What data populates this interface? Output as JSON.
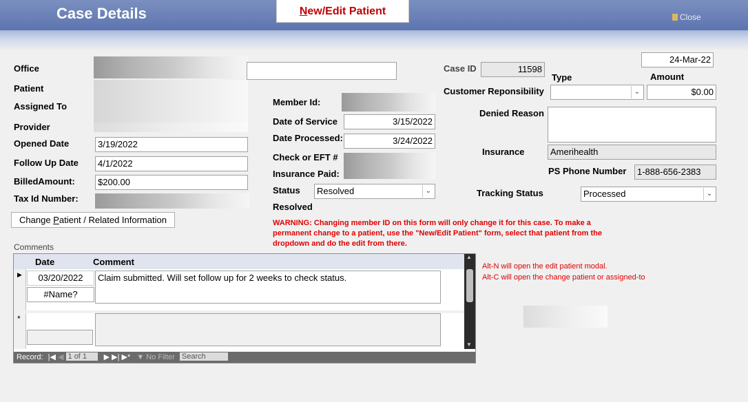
{
  "header": {
    "title": "Case Details",
    "new_edit_button": {
      "accel": "N",
      "rest": "ew/Edit Patient"
    },
    "close_label": "Close"
  },
  "left": {
    "office_label": "Office",
    "patient_label": "Patient",
    "assigned_to_label": "Assigned To",
    "provider_label": "Provider",
    "opened_date_label": "Opened Date",
    "opened_date": "3/19/2022",
    "follow_up_label": "Follow Up Date",
    "follow_up_date": "4/1/2022",
    "billed_amount_label": "BilledAmount:",
    "billed_amount": "$200.00",
    "tax_id_label": "Tax Id Number:",
    "change_button": {
      "pre": "Change ",
      "accel": "P",
      "post": "atient / Related Information"
    }
  },
  "middle": {
    "member_id_label": "Member Id:",
    "date_of_service_label": "Date of Service",
    "date_of_service": "3/15/2022",
    "date_processed_label": "Date Processed:",
    "date_processed": "3/24/2022",
    "check_eft_label": "Check or EFT #",
    "insurance_paid_label": "Insurance Paid:",
    "status_label": "Status",
    "status_value": "Resolved",
    "resolved_label": "Resolved",
    "warning": "WARNING: Changing member ID on this form will only change it for this case. To make a permanent change to a patient, use the \"New/Edit Patient\" form, select that patient from the dropdown and do the edit from there."
  },
  "right": {
    "date_stamp": "24-Mar-22",
    "case_id_label": "Case ID",
    "case_id": "11598",
    "type_label": "Type",
    "amount_label": "Amount",
    "customer_responsibility_label": "Customer Reponsibility",
    "amount": "$0.00",
    "denied_reason_label": "Denied Reason",
    "insurance_label": "Insurance",
    "insurance_value": "Amerihealth",
    "ps_phone_label": "PS Phone Number",
    "ps_phone_value": "1-888-656-2383",
    "tracking_status_label": "Tracking Status",
    "tracking_status_value": "Processed"
  },
  "comments": {
    "section_label": "Comments",
    "col_date": "Date",
    "col_comment": "Comment",
    "rows": [
      {
        "date": "03/20/2022",
        "user": "#Name?",
        "comment": "Claim submitted. Will set follow up for 2 weeks to check status."
      }
    ],
    "new_row_marker": "*",
    "nav": {
      "record_label": "Record:",
      "position": "1 of 1",
      "no_filter": "No Filter",
      "search_placeholder": "Search"
    }
  },
  "hints": {
    "line1": "Alt-N will open the edit patient modal.",
    "line2": "Alt-C will open the change patient or assigned-to"
  }
}
